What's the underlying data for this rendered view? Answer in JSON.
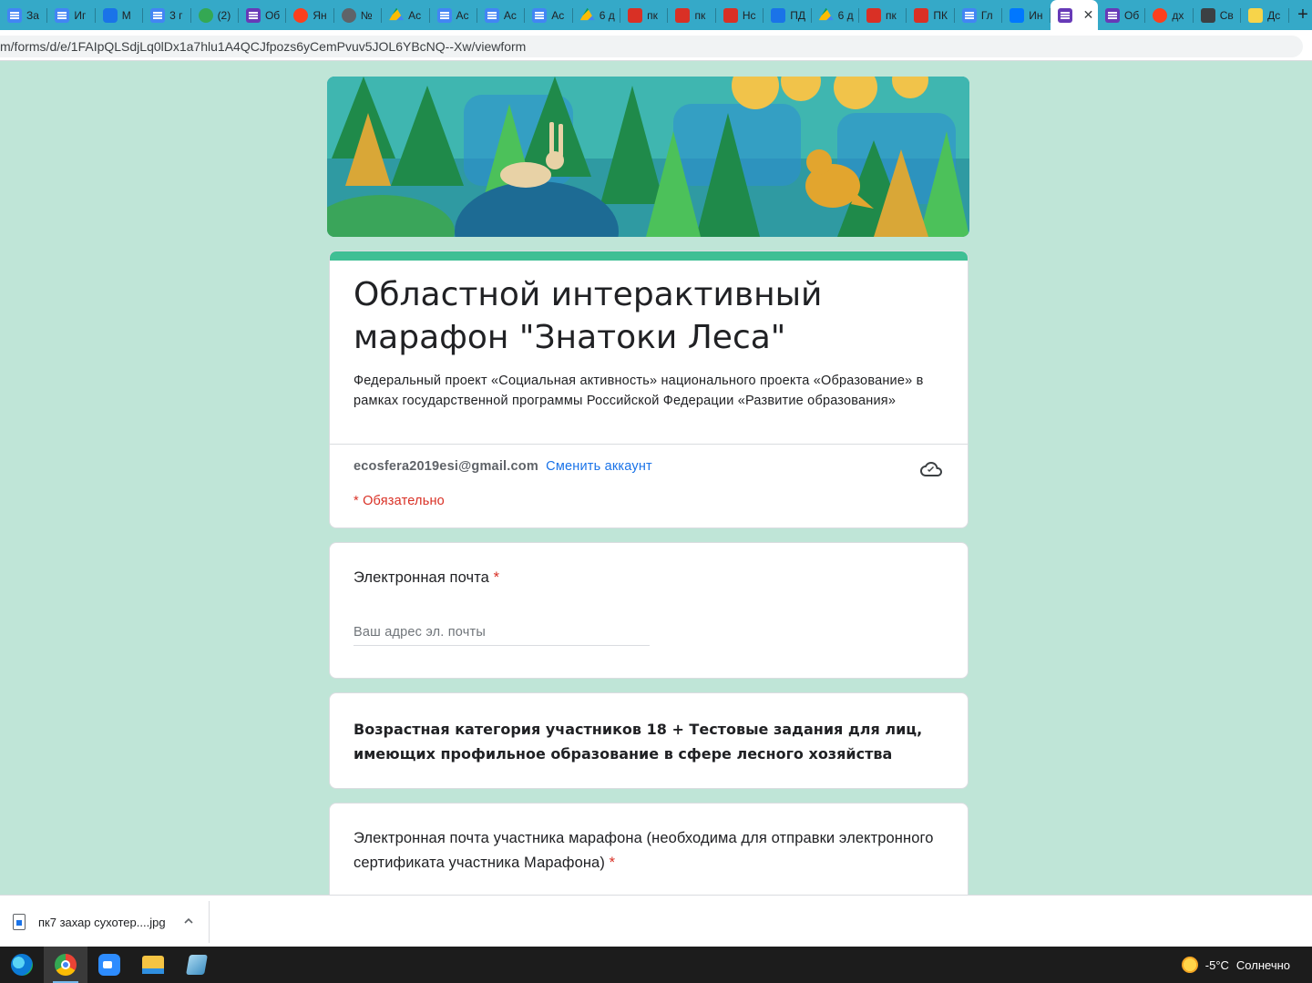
{
  "browser": {
    "tabs": [
      {
        "label": "За",
        "icon": "doc-icon"
      },
      {
        "label": "Иг",
        "icon": "doc-icon"
      },
      {
        "label": "М",
        "icon": "chat-icon"
      },
      {
        "label": "3 г",
        "icon": "doc-icon"
      },
      {
        "label": "(2)",
        "icon": "whatsapp-icon"
      },
      {
        "label": "Об",
        "icon": "forms-icon"
      },
      {
        "label": "Ян",
        "icon": "yandex-icon"
      },
      {
        "label": "№",
        "icon": "globe-icon"
      },
      {
        "label": "Ас",
        "icon": "drive-icon"
      },
      {
        "label": "Ас",
        "icon": "doc-icon"
      },
      {
        "label": "Ас",
        "icon": "doc-icon"
      },
      {
        "label": "Ас",
        "icon": "doc-icon"
      },
      {
        "label": "6 д",
        "icon": "drive-icon"
      },
      {
        "label": "пк",
        "icon": "red-icon"
      },
      {
        "label": "пк",
        "icon": "red-icon"
      },
      {
        "label": "Нс",
        "icon": "red-icon"
      },
      {
        "label": "ПД",
        "icon": "blue-grid-icon"
      },
      {
        "label": "6 д",
        "icon": "drive-icon"
      },
      {
        "label": "пк",
        "icon": "red-icon"
      },
      {
        "label": "ПК",
        "icon": "red-icon"
      },
      {
        "label": "Гл",
        "icon": "doc-icon"
      },
      {
        "label": "Ин",
        "icon": "vk-icon"
      },
      {
        "label": "",
        "icon": "forms-icon",
        "active": true
      },
      {
        "label": "Об",
        "icon": "forms-icon"
      },
      {
        "label": "дх",
        "icon": "yandex-icon"
      },
      {
        "label": "Св",
        "icon": "dark-icon"
      },
      {
        "label": "Дс",
        "icon": "yellow-icon"
      }
    ],
    "close_tab_symbol": "✕",
    "new_tab_symbol": "+",
    "url": "m/forms/d/e/1FAIpQLSdjLq0lDx1a7hlu1A4QCJfpozs6yCemPvuv5JOL6YBcNQ--Xw/viewform"
  },
  "form": {
    "title": "Областной интерактивный марафон \"Знатоки Леса\"",
    "description": "Федеральный проект «Социальная активность» национального проекта «Образование» в рамках государственной программы Российской Федерации «Развитие образования»",
    "account_email": "ecosfera2019esi@gmail.com",
    "switch_account": "Сменить аккаунт",
    "required_note": "* Обязательно",
    "email_question": {
      "label": "Электронная почта",
      "required_mark": "*",
      "placeholder": "Ваш адрес эл. почты"
    },
    "section_text": "Возрастная категория участников 18 + Тестовые задания для лиц, имеющих профильное образование в сфере лесного хозяйства",
    "participant_question": {
      "label": "Электронная почта участника марафона (необходима для отправки электронного сертификата участника Марафона)",
      "required_mark": "*"
    }
  },
  "downloads": {
    "file_name": "пк7 захар сухотер....jpg",
    "chevron": "^"
  },
  "taskbar": {
    "apps": [
      "edge-icon",
      "chrome-icon",
      "zoom-icon",
      "explorer-icon",
      "notes-icon"
    ],
    "active_app": "chrome-icon",
    "weather_temp": "-5°C",
    "weather_text": "Солнечно"
  },
  "colors": {
    "page_background": "#bfe5d7",
    "accent": "#3fbf94",
    "required": "#d93025",
    "link": "#1a73e8",
    "tabstrip": "#35a9c8"
  }
}
